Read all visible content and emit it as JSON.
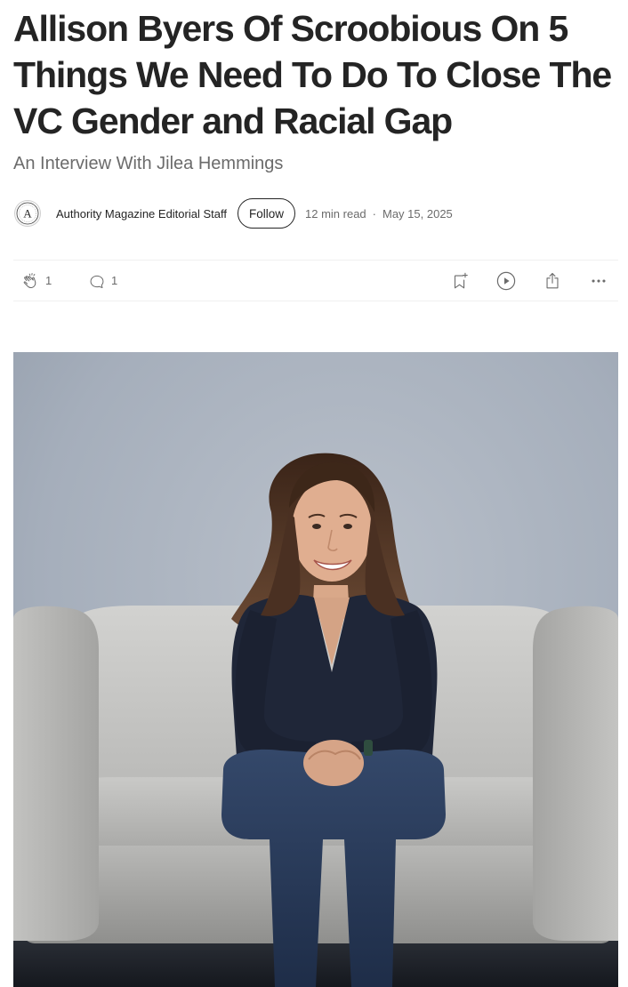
{
  "article": {
    "title": "Allison Byers Of Scroobious On 5 Things We Need To Do To Close The VC Gender and Racial Gap",
    "subtitle": "An Interview With Jilea Hemmings"
  },
  "byline": {
    "avatar_letter": "A",
    "author": "Authority Magazine Editorial Staff",
    "follow_label": "Follow",
    "read_time": "12 min read",
    "separator": "·",
    "date": "May 15, 2025"
  },
  "actions": {
    "clap_icon": "clap-icon",
    "clap_count": "1",
    "response_icon": "speech-bubble-icon",
    "response_count": "1",
    "save_icon": "bookmark-add-icon",
    "listen_icon": "play-circle-icon",
    "share_icon": "share-icon",
    "more_icon": "more-horizontal-icon"
  },
  "colors": {
    "text_primary": "#242424",
    "text_secondary": "#6b6b6b",
    "divider": "#f0f0f0",
    "photo_backdrop": "#a9b2be",
    "sofa": "#c9c9c7",
    "sweater": "#1f2638",
    "jeans": "#2d3f5f"
  }
}
